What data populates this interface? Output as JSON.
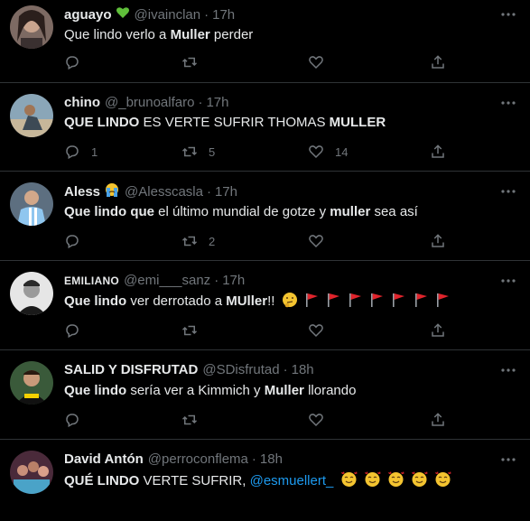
{
  "tweets": [
    {
      "display_name": "aguayo",
      "badge": "green-heart",
      "handle": "@ivainclan",
      "time": "17h",
      "text_parts": [
        {
          "t": "Que lindo verlo a ",
          "b": false
        },
        {
          "t": "Muller",
          "b": true
        },
        {
          "t": " perder",
          "b": false
        }
      ],
      "replies": "",
      "retweets": "",
      "likes": ""
    },
    {
      "display_name": "chino",
      "badge": "",
      "handle": "@_brunoalfaro",
      "time": "17h",
      "text_parts": [
        {
          "t": "QUE LINDO",
          "b": true
        },
        {
          "t": " ES VERTE SUFRIR THOMAS ",
          "b": false
        },
        {
          "t": "MULLER",
          "b": true
        }
      ],
      "replies": "1",
      "retweets": "5",
      "likes": "14"
    },
    {
      "display_name": "Aless",
      "badge": "crying-face",
      "handle": "@Alesscasla",
      "time": "17h",
      "text_parts": [
        {
          "t": "Que lindo que",
          "b": true
        },
        {
          "t": " el último mundial de gotze y ",
          "b": false
        },
        {
          "t": "muller",
          "b": true
        },
        {
          "t": " sea así",
          "b": false
        }
      ],
      "replies": "",
      "retweets": "2",
      "likes": ""
    },
    {
      "display_name": "EMILIANO",
      "badge": "",
      "handle": "@emi___sanz",
      "time": "17h",
      "text_parts": [
        {
          "t": "Que lindo",
          "b": true
        },
        {
          "t": " ver derrotado a ",
          "b": false
        },
        {
          "t": "MUller",
          "b": true
        },
        {
          "t": "!!",
          "b": false
        }
      ],
      "trailing_emoji": [
        "thinking-face",
        "red-flag",
        "red-flag",
        "red-flag",
        "red-flag",
        "red-flag",
        "red-flag",
        "red-flag"
      ],
      "replies": "",
      "retweets": "",
      "likes": ""
    },
    {
      "display_name": "SALID Y DISFRUTAD",
      "badge": "",
      "handle": "@SDisfrutad",
      "time": "18h",
      "text_parts": [
        {
          "t": "Que lindo",
          "b": true
        },
        {
          "t": " sería ver a Kimmich y ",
          "b": false
        },
        {
          "t": "Muller",
          "b": true
        },
        {
          "t": " llorando",
          "b": false
        }
      ],
      "replies": "",
      "retweets": "",
      "likes": ""
    },
    {
      "display_name": "David Antón",
      "badge": "",
      "handle": "@perroconflema",
      "time": "18h",
      "text_parts": [
        {
          "t": "QUÉ LINDO",
          "b": true
        },
        {
          "t": " VERTE SUFRIR, ",
          "b": false
        }
      ],
      "mention": "@esmuellert_",
      "trailing_emoji": [
        "smiling-face-with-hearts",
        "smiling-face-with-hearts",
        "smiling-face-with-hearts",
        "smiling-face-with-hearts",
        "smiling-face-with-hearts"
      ],
      "replies": "",
      "retweets": "",
      "likes": ""
    }
  ],
  "colors": {
    "background": "#000000",
    "text": "#e7e9ea",
    "muted": "#71767b",
    "divider": "#2f3336",
    "mention": "#1d9bf0"
  },
  "icons": [
    "reply-icon",
    "retweet-icon",
    "like-icon",
    "share-icon",
    "more-icon"
  ]
}
